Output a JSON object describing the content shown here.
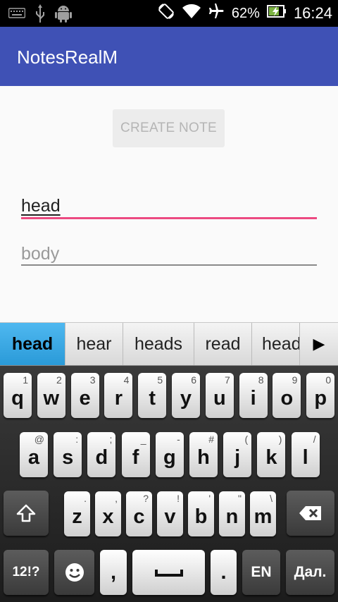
{
  "status_bar": {
    "battery": "62%",
    "time": "16:24",
    "icons": [
      "keyboard-icon",
      "usb-icon",
      "android-icon",
      "rotate-icon",
      "wifi-icon",
      "airplane-icon",
      "battery-icon"
    ]
  },
  "app_bar": {
    "title": "NotesRealM"
  },
  "main": {
    "create_button": "CREATE NOTE",
    "head_field": {
      "value": "head"
    },
    "body_field": {
      "placeholder": "body"
    }
  },
  "suggestions": [
    "head",
    "hear",
    "heads",
    "read",
    "head"
  ],
  "keyboard": {
    "row1": [
      {
        "k": "q",
        "a": "1"
      },
      {
        "k": "w",
        "a": "2"
      },
      {
        "k": "e",
        "a": "3"
      },
      {
        "k": "r",
        "a": "4"
      },
      {
        "k": "t",
        "a": "5"
      },
      {
        "k": "y",
        "a": "6"
      },
      {
        "k": "u",
        "a": "7"
      },
      {
        "k": "i",
        "a": "8"
      },
      {
        "k": "o",
        "a": "9"
      },
      {
        "k": "p",
        "a": "0"
      }
    ],
    "row2": [
      {
        "k": "a",
        "a": "@"
      },
      {
        "k": "s",
        "a": ":"
      },
      {
        "k": "d",
        "a": ";"
      },
      {
        "k": "f",
        "a": "_"
      },
      {
        "k": "g",
        "a": "-"
      },
      {
        "k": "h",
        "a": "#"
      },
      {
        "k": "j",
        "a": "("
      },
      {
        "k": "k",
        "a": ")"
      },
      {
        "k": "l",
        "a": "/"
      }
    ],
    "row3": [
      {
        "k": "z",
        "a": "."
      },
      {
        "k": "x",
        "a": ","
      },
      {
        "k": "c",
        "a": "?"
      },
      {
        "k": "v",
        "a": "!"
      },
      {
        "k": "b",
        "a": "'"
      },
      {
        "k": "n",
        "a": "\""
      },
      {
        "k": "m",
        "a": "\\"
      }
    ],
    "symbols_label": "12!?",
    "comma_label": ",",
    "period_label": ".",
    "language_label": "EN",
    "next_label": "Дал."
  }
}
